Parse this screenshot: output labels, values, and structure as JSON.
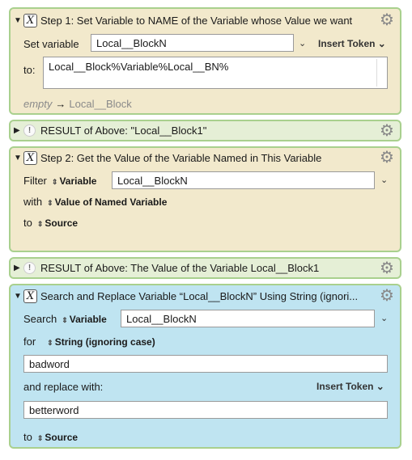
{
  "step1": {
    "title": "Step 1:  Set Variable to NAME of the Variable whose Value we want",
    "set_variable_label": "Set variable",
    "variable_value": "Local__BlockN",
    "insert_token": "Insert Token",
    "to_label": "to:",
    "to_value": "Local__Block%Variable%Local__BN%",
    "preview_empty": "empty",
    "preview_arrow": "→",
    "preview_value": "Local__Block"
  },
  "result1": {
    "title": "RESULT of Above:  \"Local__Block1\""
  },
  "step2": {
    "title": "Step 2:  Get the Value of the Variable Named in This Variable",
    "filter_label": "Filter",
    "filter_source": "Variable",
    "variable_value": "Local__BlockN",
    "with_label": "with",
    "with_value": "Value of Named Variable",
    "to_label": "to",
    "to_value": "Source"
  },
  "result2": {
    "title": "RESULT of Above:  The Value of the Variable Local__Block1"
  },
  "step3": {
    "title": "Search and Replace Variable “Local__BlockN” Using String (ignori...",
    "search_label": "Search",
    "search_source": "Variable",
    "variable_value": "Local__BlockN",
    "for_label": "for",
    "for_value": "String (ignoring case)",
    "search_text": "badword",
    "replace_label": "and replace with:",
    "insert_token": "Insert Token",
    "replace_text": "betterword",
    "to_label": "to",
    "to_value": "Source"
  },
  "icons": {
    "disclosure_open": "triangle-down-icon",
    "disclosure_closed": "triangle-right-icon",
    "action": "x-script-icon",
    "result": "exclamation-icon",
    "gear": "gear-icon",
    "chevron": "chevron-down-icon",
    "stepper": "updown-stepper-icon"
  },
  "colors": {
    "tan": "#f2e9cc",
    "green": "#e5efd6",
    "blue": "#bfe4f1",
    "border": "#a9d08e"
  }
}
